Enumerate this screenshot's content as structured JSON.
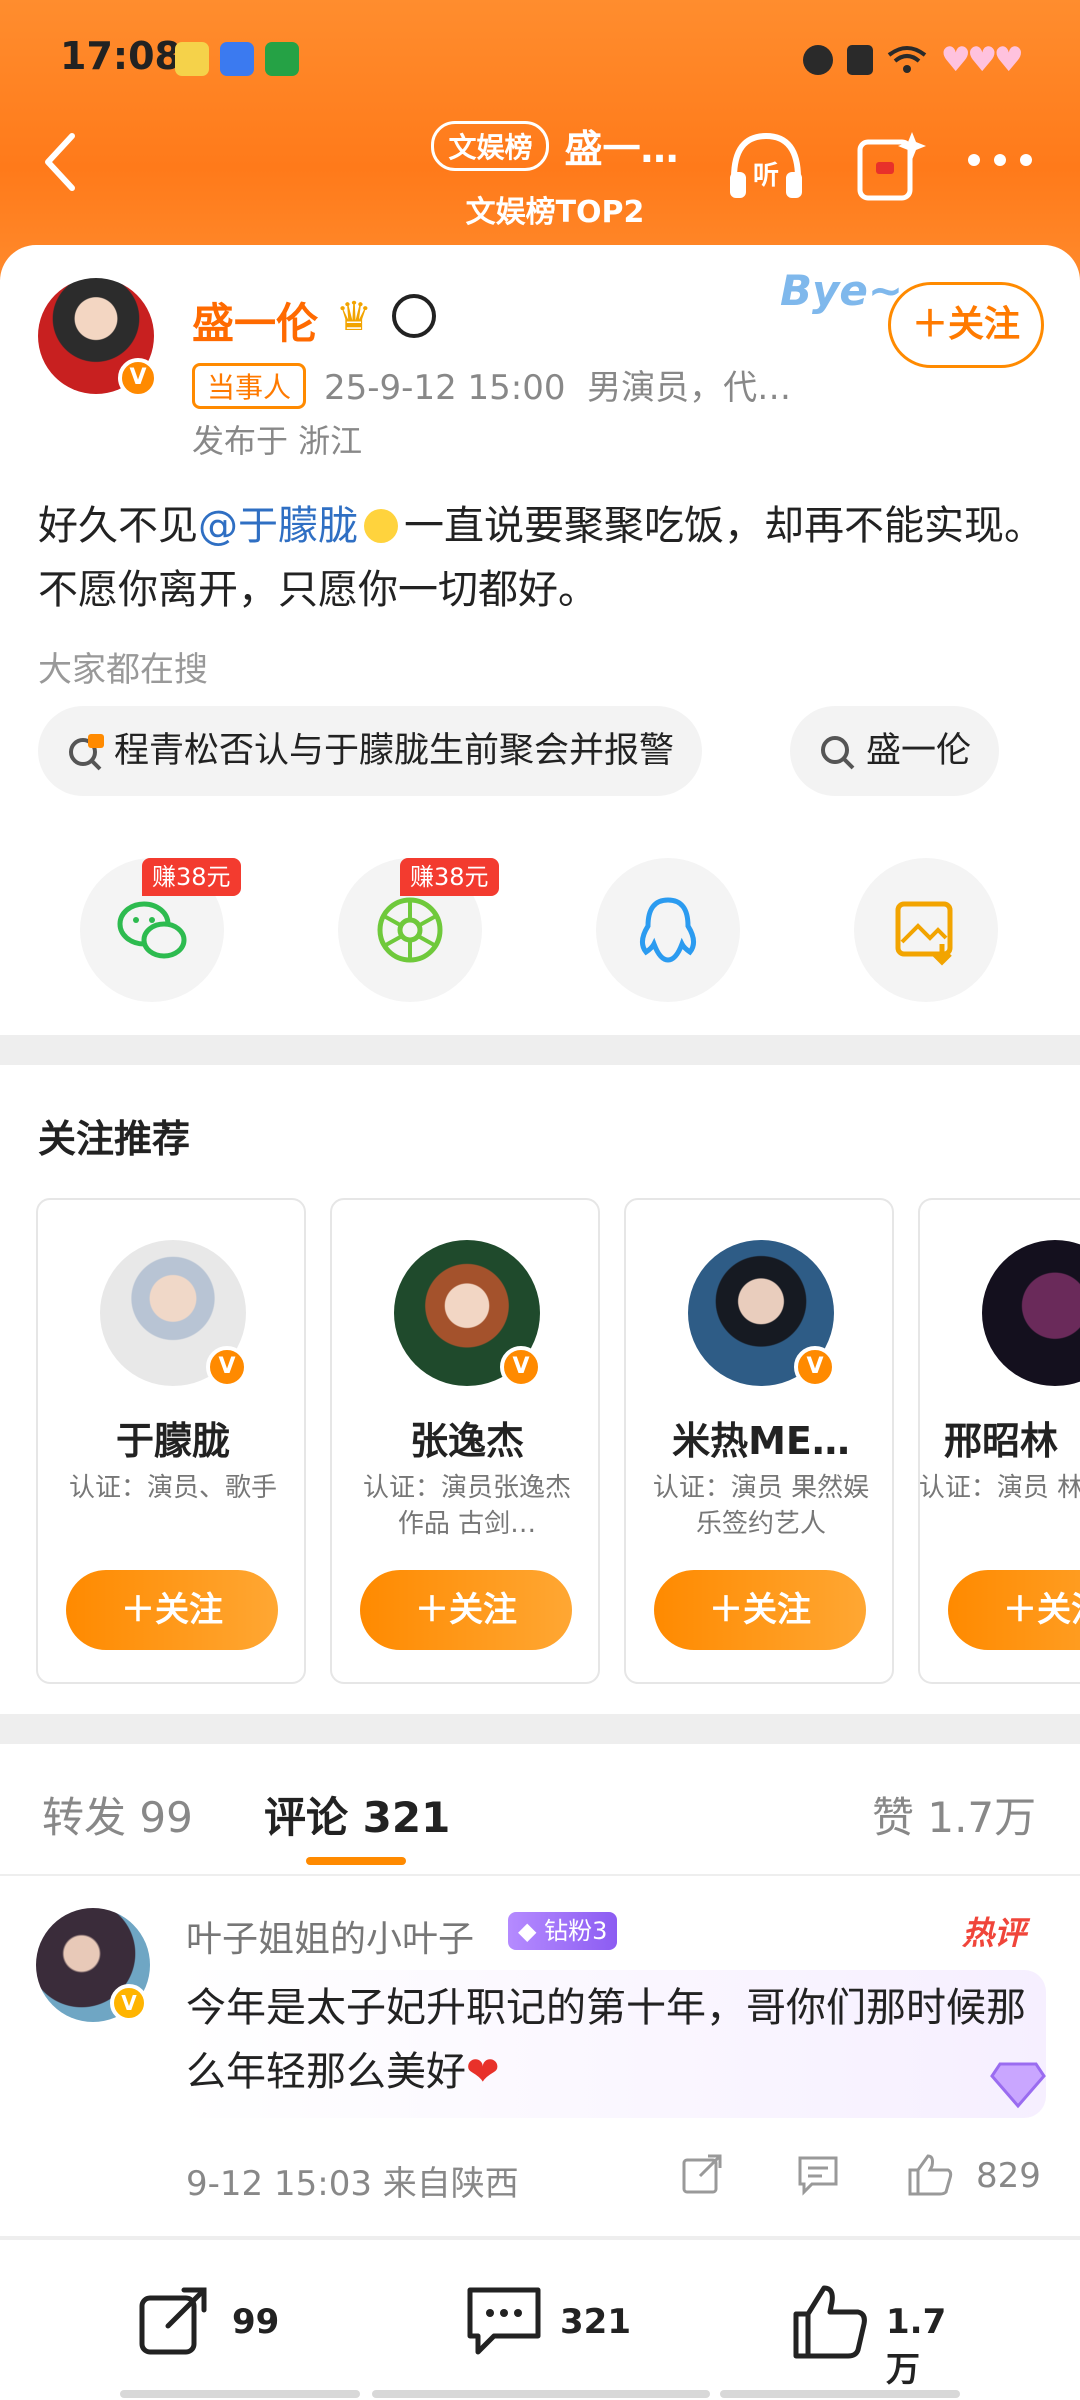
{
  "status_bar": {
    "time": "17:08"
  },
  "nav": {
    "tag": "文娱榜",
    "title": "盛一…",
    "subtitle": "文娱榜TOP2"
  },
  "post": {
    "author": "盛一伦",
    "follow_label": "＋关注",
    "role_tag": "当事人",
    "datetime": "25-9-12 15:00",
    "author_desc": "男演员，代…",
    "location": "发布于 浙江",
    "text_before": "好久不见",
    "mention": "@于朦胧",
    "text_after": "一直说要聚聚吃饭，却再不能实现。不愿你离开，只愿你一切都好。",
    "sticker_text": "Bye~",
    "search_label": "大家都在搜",
    "search_chips": [
      "程青松否认与于朦胧生前聚会并报警",
      "盛一伦"
    ],
    "share_targets": [
      {
        "name": "wechat-icon",
        "bonus": "赚38元",
        "color": "#2dbb4f"
      },
      {
        "name": "moments-icon",
        "bonus": "赚38元",
        "color": "#6fc93b"
      },
      {
        "name": "qq-icon",
        "bonus": "",
        "color": "#2b9bf0"
      },
      {
        "name": "save-image-icon",
        "bonus": "",
        "color": "#f2a400"
      }
    ]
  },
  "recommend": {
    "title": "关注推荐",
    "users": [
      {
        "name": "于朦胧",
        "desc": "认证：演员、歌手",
        "button": "＋关注"
      },
      {
        "name": "张逸杰",
        "desc": "认证：演员张逸杰 作品 古剑…",
        "button": "＋关注"
      },
      {
        "name": "米热ME…",
        "desc": "认证：演员 果然娱乐签约艺人",
        "button": "＋关注"
      },
      {
        "name": "邢昭林",
        "desc": "认证：演员 林",
        "button": "＋关注"
      }
    ]
  },
  "tabs": {
    "repost": "转发 99",
    "comments": "评论 321",
    "likes": "赞 1.7万"
  },
  "comment": {
    "user": "叶子姐姐的小叶子",
    "fan_badge": "钻粉3",
    "hot_tag": "热评",
    "text": "今年是太子妃升职记的第十年，哥你们那时候那么年轻那么美好",
    "meta": "9-12 15:03 来自陕西",
    "likes": "829"
  },
  "bottom_bar": {
    "repost": "99",
    "comment": "321",
    "like": "1.7万"
  },
  "colors": {
    "accent": "#ff8a00",
    "brand_orange": "#ff7a1a",
    "link": "#2f6fc3"
  }
}
